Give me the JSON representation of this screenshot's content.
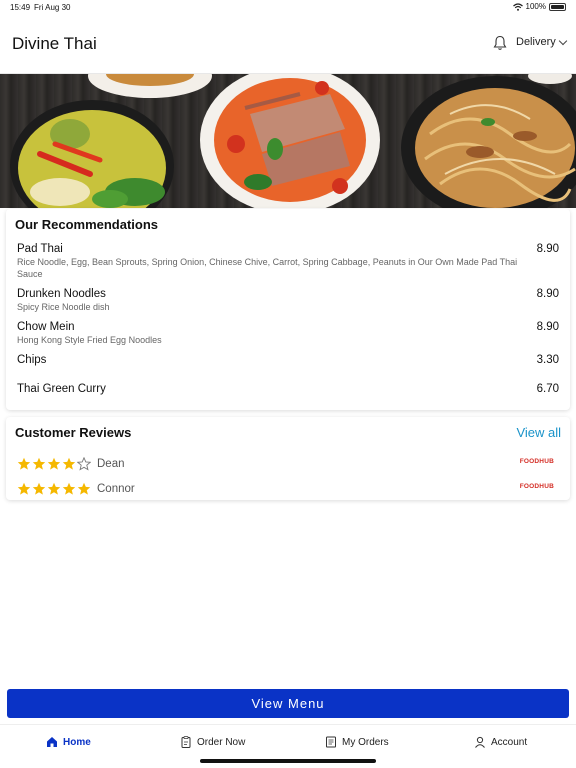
{
  "status_bar": {
    "time": "15:49",
    "date": "Fri Aug 30",
    "battery": "100%"
  },
  "header": {
    "title": "Divine Thai",
    "order_mode": "Delivery"
  },
  "recommendations": {
    "title": "Our Recommendations",
    "items": [
      {
        "name": "Pad Thai",
        "description": "Rice Noodle, Egg, Bean Sprouts, Spring Onion, Chinese Chive, Carrot, Spring Cabbage, Peanuts in Our Own Made Pad Thai Sauce",
        "price": "8.90"
      },
      {
        "name": "Drunken Noodles",
        "description": "Spicy Rice Noodle dish",
        "price": "8.90"
      },
      {
        "name": "Chow Mein",
        "description": "Hong Kong Style Fried Egg Noodles",
        "price": "8.90"
      },
      {
        "name": "Chips",
        "description": "",
        "price": "3.30"
      },
      {
        "name": "Thai Green Curry",
        "description": "",
        "price": "6.70"
      }
    ]
  },
  "reviews": {
    "title": "Customer Reviews",
    "view_all_label": "View all",
    "items": [
      {
        "name": "Dean",
        "rating": 4,
        "source": "FOODHUB"
      },
      {
        "name": "Connor",
        "rating": 5,
        "source": "FOODHUB"
      }
    ]
  },
  "cta": {
    "label": "View Menu"
  },
  "tabs": [
    {
      "label": "Home",
      "icon": "home-icon",
      "active": true
    },
    {
      "label": "Order Now",
      "icon": "clipboard-icon",
      "active": false
    },
    {
      "label": "My Orders",
      "icon": "receipt-icon",
      "active": false
    },
    {
      "label": "Account",
      "icon": "user-icon",
      "active": false
    }
  ],
  "colors": {
    "primary": "#0a33c6",
    "link": "#1a93c9",
    "star": "#f5b800",
    "source_logo": "#d42e26"
  }
}
